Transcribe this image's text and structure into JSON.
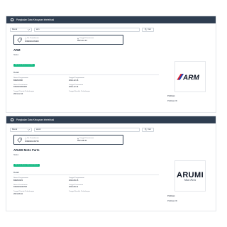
{
  "panels": [
    {
      "header_title": "Pangkalan Data Kekayaan Intelektual",
      "search": {
        "type_value": "Merek",
        "query_value": "arm",
        "button_label": "Cari"
      },
      "info": {
        "app_no_label": "No. Permohonan",
        "app_no_value": "DID2021009400",
        "receipt_date_label": "Tanggal Penerimaan",
        "receipt_date_value": "2021-12-14"
      },
      "brand_name": "ARM",
      "status_label": "Status",
      "status_badge": "TM-Pemeriksaan Formalitas",
      "detail_title": "Detail",
      "fields": [
        {
          "label": "Nomor Pengumuman",
          "value": "BRM21500"
        },
        {
          "label": "Tanggal Pengumuman",
          "value": "2021-12-16"
        },
        {
          "label": "Nomor Permohonan",
          "value": "DID2021009400"
        },
        {
          "label": "Tanggal Penerimaan",
          "value": "2021-12-14"
        },
        {
          "label": "Tanggal Dimulai Perlindungan",
          "value": "2021-12-14"
        },
        {
          "label": "Tanggal Berakhir Perlindungan",
          "value": ""
        }
      ],
      "side": {
        "l1": "Publikasi",
        "l2": "Publikasi ID"
      },
      "logo_text": "ARM"
    },
    {
      "header_title": "Pangkalan Data Kekayaan Intelektual",
      "search": {
        "type_value": "Merek",
        "query_value": "arumi",
        "button_label": "Cari"
      },
      "info": {
        "app_no_label": "No. Permohonan",
        "app_no_value": "DID2021049725",
        "receipt_date_label": "Tanggal Penerimaan",
        "receipt_date_value": "2021-08-11"
      },
      "brand_name": "ARUMI Moto Parts",
      "status_label": "Status",
      "status_badge": "TM-Pemeriksaan Substantif Selesai",
      "detail_title": "Detail",
      "fields": [
        {
          "label": "Nomor Pengumuman",
          "value": "BRM21523"
        },
        {
          "label": "Tanggal Pengumuman",
          "value": "2021-08-15"
        },
        {
          "label": "Nomor Permohonan",
          "value": "DID2021049725"
        },
        {
          "label": "Tanggal Penerimaan",
          "value": "2021-08-11"
        },
        {
          "label": "Tanggal Dimulai Perlindungan",
          "value": "2021-08-11"
        },
        {
          "label": "Tanggal Berakhir Perlindungan",
          "value": ""
        }
      ],
      "side": {
        "l1": "Publikasi",
        "l2": "Publikasi ID"
      },
      "logo_big": "ARUMI",
      "logo_small": "Moto Parts"
    }
  ],
  "icons": {
    "header": "document-icon",
    "search_type_chevron": "chevron-down-icon",
    "search_button": "search-icon",
    "tag": "tag-icon",
    "app_no": "info-icon",
    "receipt_date": "calendar-icon"
  },
  "colors": {
    "header_bg": "#2f3e51",
    "status_green": "#10b981",
    "logo_red": "#e11d2a",
    "logo_blue": "#1e40af"
  }
}
